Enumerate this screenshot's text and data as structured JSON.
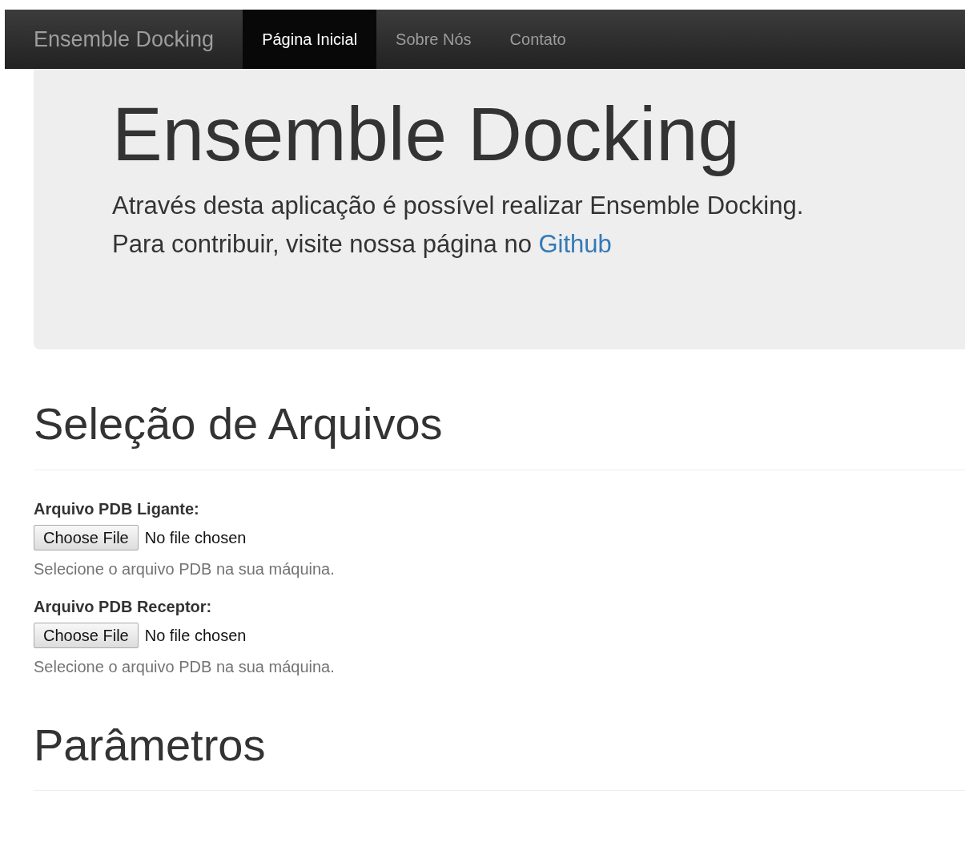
{
  "navbar": {
    "brand": "Ensemble Docking",
    "items": [
      {
        "label": "Página Inicial",
        "selected": true
      },
      {
        "label": "Sobre Nós",
        "selected": false
      },
      {
        "label": "Contato",
        "selected": false
      }
    ]
  },
  "jumbotron": {
    "title": "Ensemble Docking",
    "lines": [
      "Através desta aplicação é possível realizar Ensemble Docking."
    ],
    "contribute_text": "Para contribuir, visite nossa página no",
    "link": "Github"
  },
  "sections": [
    {
      "heading": "Seleção de Arquivos",
      "fields": [
        {
          "label": "Arquivo PDB Ligante:",
          "button": "Choose File",
          "status": "No file chosen",
          "help": "Selecione o arquivo PDB na sua máquina."
        },
        {
          "label": "Arquivo PDB Receptor:",
          "button": "Choose File",
          "status": "No file chosen",
          "help": "Selecione o arquivo PDB na sua máquina."
        }
      ]
    },
    {
      "heading": "Parâmetros"
    }
  ]
}
